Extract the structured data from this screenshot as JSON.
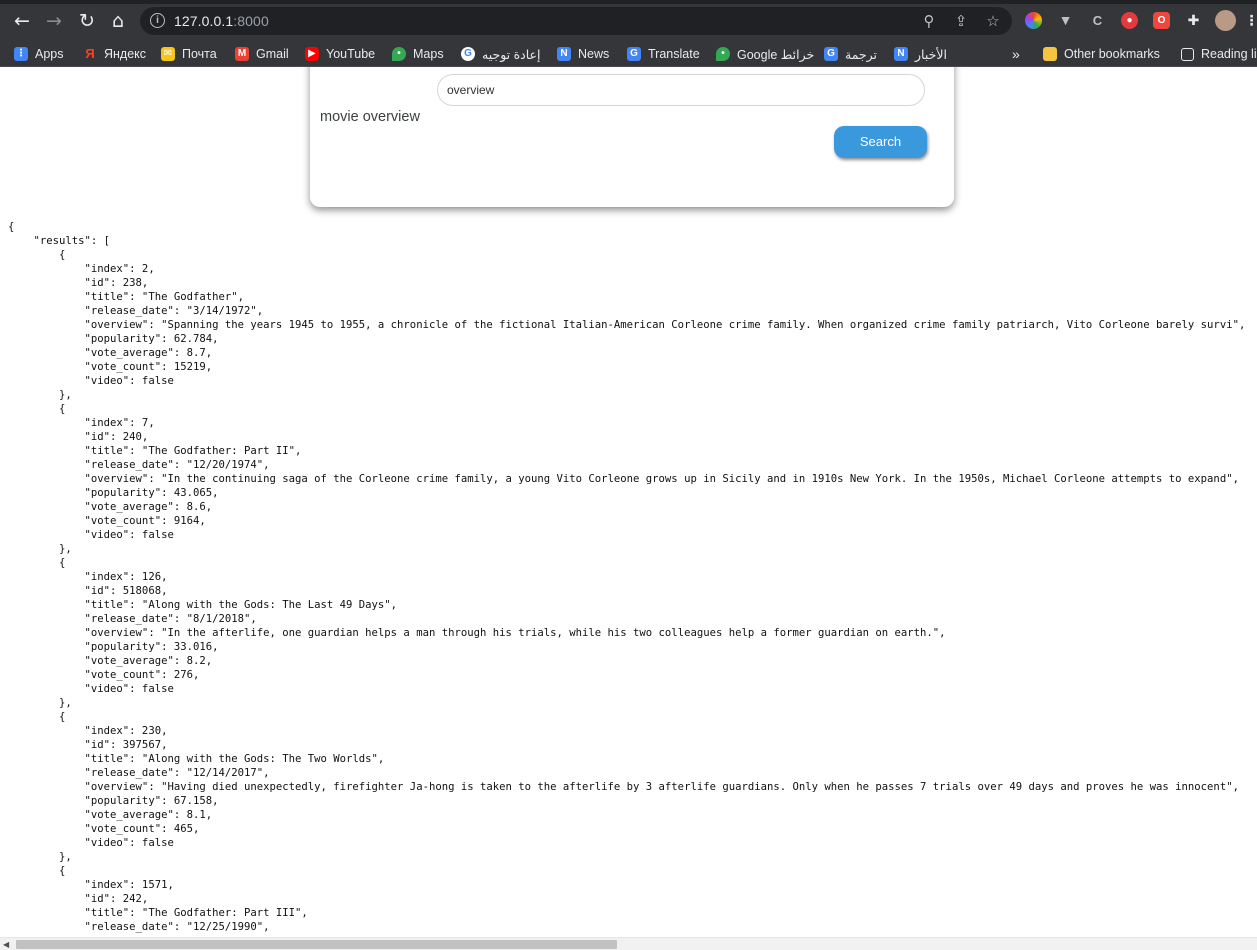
{
  "browser": {
    "url_host": "127.0.0.1",
    "url_port": ":8000",
    "bookmarks": [
      {
        "label": "Apps",
        "icon": "apps-grid-icon",
        "color": "#4285f4"
      },
      {
        "label": "Яндекс",
        "icon": "yandex-icon",
        "color": "#fc3f1d"
      },
      {
        "label": "Почта",
        "icon": "mail-icon",
        "color": "#f5c518"
      },
      {
        "label": "Gmail",
        "icon": "gmail-icon",
        "color": "#ea4335"
      },
      {
        "label": "YouTube",
        "icon": "youtube-icon",
        "color": "#ff0000"
      },
      {
        "label": "Maps",
        "icon": "maps-pin-icon",
        "color": "#34a853"
      },
      {
        "label": "إعادة توجيه",
        "icon": "google-icon",
        "color": "#4285f4"
      },
      {
        "label": "News",
        "icon": "news-icon",
        "color": "#4285f4"
      },
      {
        "label": "Translate",
        "icon": "translate-icon",
        "color": "#4285f4"
      },
      {
        "label": "Google خرائط",
        "icon": "maps-pin-icon",
        "color": "#34a853"
      },
      {
        "label": "ترجمة",
        "icon": "translate-icon",
        "color": "#4285f4"
      },
      {
        "label": "الأخبار",
        "icon": "news-icon",
        "color": "#4285f4"
      }
    ],
    "other_bookmarks": "Other bookmarks",
    "reading_list": "Reading li"
  },
  "form": {
    "overview_label": "movie overview",
    "overview_value": "overview",
    "search_label": "Search"
  },
  "results": [
    {
      "index": "2",
      "id": "238",
      "title": "The Godfather",
      "release_date": "3/14/1972",
      "overview": "Spanning the years 1945 to 1955, a chronicle of the fictional Italian-American Corleone crime family. When organized crime family patriarch, Vito Corleone barely survi",
      "popularity": "62.784",
      "vote_average": "8.7",
      "vote_count": "15219",
      "video": "false"
    },
    {
      "index": "7",
      "id": "240",
      "title": "The Godfather: Part II",
      "release_date": "12/20/1974",
      "overview": "In the continuing saga of the Corleone crime family, a young Vito Corleone grows up in Sicily and in 1910s New York. In the 1950s, Michael Corleone attempts to expand",
      "popularity": "43.065",
      "vote_average": "8.6",
      "vote_count": "9164",
      "video": "false"
    },
    {
      "index": "126",
      "id": "518068",
      "title": "Along with the Gods: The Last 49 Days",
      "release_date": "8/1/2018",
      "overview": "In the afterlife, one guardian helps a man through his trials, while his two colleagues help a former guardian on earth.",
      "popularity": "33.016",
      "vote_average": "8.2",
      "vote_count": "276",
      "video": "false"
    },
    {
      "index": "230",
      "id": "397567",
      "title": "Along with the Gods: The Two Worlds",
      "release_date": "12/14/2017",
      "overview": "Having died unexpectedly, firefighter Ja-hong is taken to the afterlife by 3 afterlife guardians. Only when he passes 7 trials over 49 days and proves he was innocent",
      "popularity": "67.158",
      "vote_average": "8.1",
      "vote_count": "465",
      "video": "false"
    },
    {
      "index": "1571",
      "id": "242",
      "title": "The Godfather: Part III",
      "release_date": "12/25/1990",
      "overview": "",
      "popularity": "",
      "vote_average": "",
      "vote_count": "",
      "video": ""
    }
  ],
  "scrollbar": {
    "horizontal_thumb_fraction": 0.49
  }
}
